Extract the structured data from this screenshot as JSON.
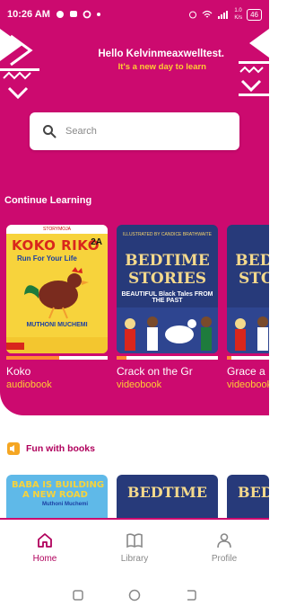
{
  "status_bar": {
    "time": "10:26 AM",
    "speed_top": "1.0",
    "speed_bottom": "K/s",
    "battery": "46"
  },
  "header": {
    "greeting": "Hello Kelvinmeaxwelltest.",
    "tagline": "It's a new day to learn"
  },
  "search": {
    "placeholder": "Search"
  },
  "continue_learning": {
    "title": "Continue Learning",
    "items": [
      {
        "title": "Koko",
        "type": "audiobook",
        "progress": 0.52
      },
      {
        "title": "Crack on the Gr",
        "type": "videobook",
        "progress": 0.1
      },
      {
        "title": "Grace a",
        "type": "videobook",
        "progress": 0.1
      }
    ]
  },
  "covers": {
    "koko": {
      "publisher": "STORYMOJA",
      "title": "KOKO RIKO",
      "level": "2A",
      "subtitle": "Run For Your Life",
      "author": "MUTHONI MUCHEMI"
    },
    "bedtime": {
      "top": "ILLUSTRATED BY CANDICE BRATHWAITE",
      "title_line1": "BEDTIME",
      "title_line2": "STORIES",
      "subtitle": "BEAUTIFUL Black Tales FROM THE PAST"
    },
    "baba": {
      "title_line1": "BABA IS BUILDING",
      "title_line2": "A NEW ROAD",
      "author": "Muthoni Muchemi"
    }
  },
  "fun_section": {
    "title": "Fun with  books"
  },
  "bottom_nav": {
    "home": "Home",
    "library": "Library",
    "profile": "Profile"
  },
  "colors": {
    "brand": "#cc0a6f",
    "accent": "#ffcc33",
    "progress": "#ff8a33"
  },
  "icons": [
    "search-icon",
    "home-icon",
    "library-icon",
    "profile-icon",
    "speaker-icon"
  ]
}
